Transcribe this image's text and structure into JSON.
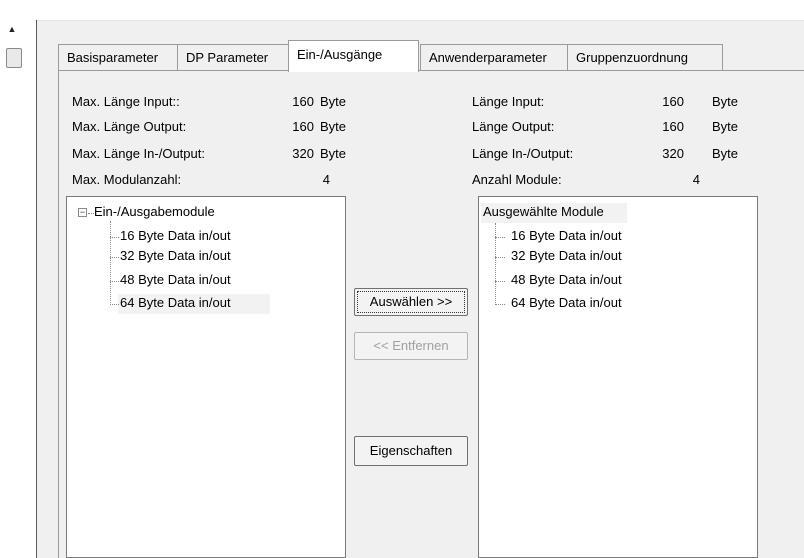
{
  "tabs": [
    {
      "label": "Basisparameter"
    },
    {
      "label": "DP Parameter"
    },
    {
      "label": "Ein-/Ausgänge"
    },
    {
      "label": "Anwenderparameter"
    },
    {
      "label": "Gruppenzuordnung"
    }
  ],
  "left_stats": [
    {
      "label": "Max. Länge Input::",
      "value": "160",
      "unit": "Byte"
    },
    {
      "label": "Max. Länge Output:",
      "value": "160",
      "unit": "Byte"
    },
    {
      "label": "Max. Länge In-/Output:",
      "value": "320",
      "unit": "Byte"
    },
    {
      "label": "Max. Modulanzahl:",
      "value": "4",
      "unit": ""
    }
  ],
  "right_stats": [
    {
      "label": "Länge Input:",
      "value": "160",
      "unit": "Byte"
    },
    {
      "label": "Länge Output:",
      "value": "160",
      "unit": "Byte"
    },
    {
      "label": "Länge In-/Output:",
      "value": "320",
      "unit": "Byte"
    },
    {
      "label": "Anzahl Module:",
      "value": "4",
      "unit": ""
    }
  ],
  "available": {
    "root": "Ein-/Ausgabemodule",
    "items": [
      "16 Byte Data in/out",
      "32 Byte Data in/out",
      "48 Byte Data in/out",
      "64 Byte Data in/out"
    ]
  },
  "selected": {
    "root": "Ausgewählte Module",
    "items": [
      "16 Byte Data in/out",
      "32 Byte Data in/out",
      "48 Byte Data in/out",
      "64 Byte Data in/out"
    ]
  },
  "buttons": {
    "select": "Auswählen >>",
    "remove": "<< Entfernen",
    "properties": "Eigenschaften"
  }
}
